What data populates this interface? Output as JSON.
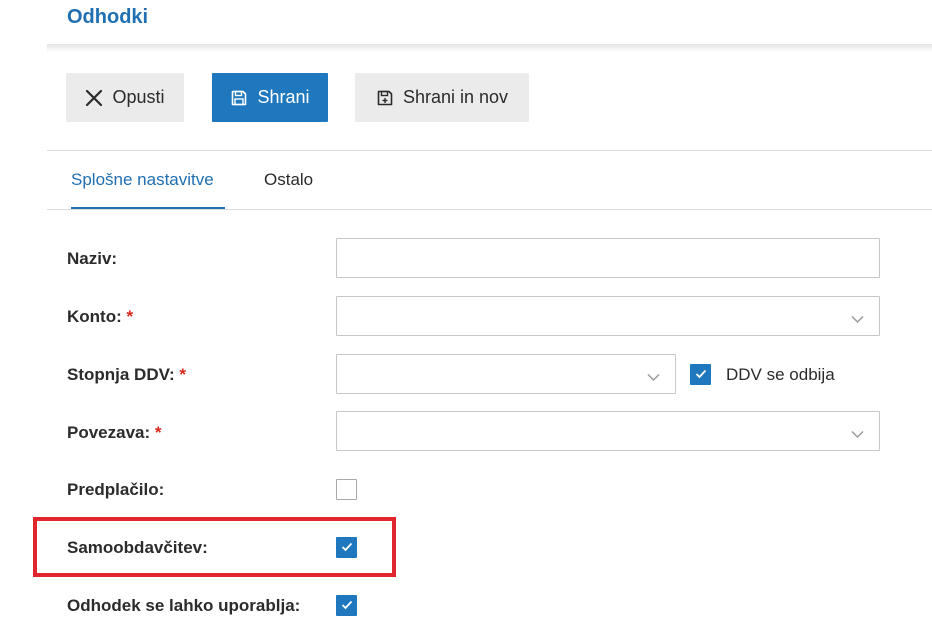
{
  "page": {
    "title": "Odhodki"
  },
  "toolbar": {
    "cancel_label": "Opusti",
    "save_label": "Shrani",
    "save_new_label": "Shrani in nov"
  },
  "tabs": [
    {
      "label": "Splošne nastavitve",
      "active": true
    },
    {
      "label": "Ostalo",
      "active": false
    }
  ],
  "form": {
    "naziv": {
      "label": "Naziv:",
      "value": ""
    },
    "konto": {
      "label": "Konto:",
      "required_mark": "*",
      "value": ""
    },
    "stopnja_ddv": {
      "label": "Stopnja DDV:",
      "required_mark": "*",
      "value": "",
      "ddv_se_odbija": {
        "label": "DDV se odbija",
        "checked": true
      }
    },
    "povezava": {
      "label": "Povezava:",
      "required_mark": "*",
      "value": ""
    },
    "predplacilo": {
      "label": "Predplačilo:",
      "checked": false
    },
    "samoobdavcitev": {
      "label": "Samoobdavčitev:",
      "checked": true
    },
    "uporablja": {
      "label": "Odhodek se lahko uporablja:",
      "checked": true
    }
  },
  "colors": {
    "brand": "#1f6fb2",
    "button_primary": "#1f78bd",
    "required": "#d9261c",
    "highlight": "#e0262c"
  },
  "icons": {
    "cancel": "close-icon",
    "save": "floppy-disk-icon",
    "save_new": "floppy-disk-plus-icon",
    "dropdown": "chevron-down-icon",
    "checkbox": "checkmark-icon"
  }
}
